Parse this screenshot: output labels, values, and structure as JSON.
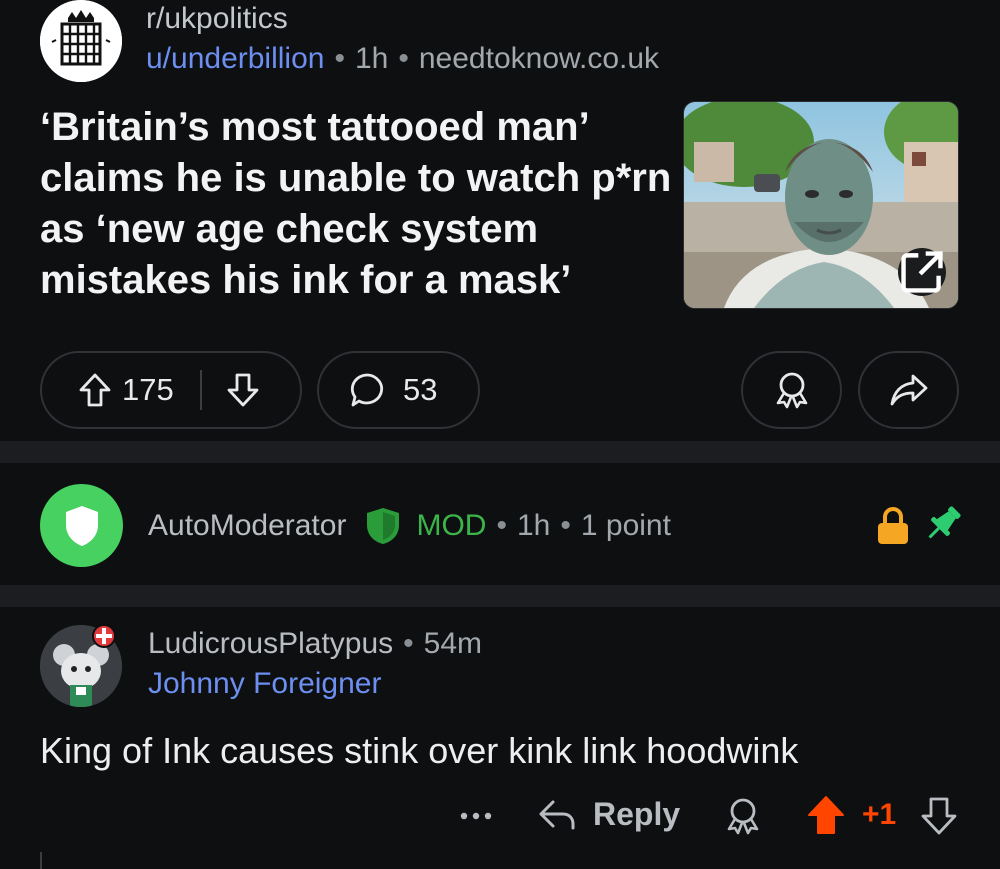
{
  "post": {
    "subreddit": "r/ukpolitics",
    "author": "u/underbillion",
    "age": "1h",
    "domain": "needtoknow.co.uk",
    "title": "‘Britain’s most tattooed man’ claims he is unable to watch p*rn as ‘new age check system mistakes his ink for a mask’",
    "score": "175",
    "comments": "53"
  },
  "automod": {
    "name": "AutoModerator",
    "badge": "MOD",
    "age": "1h",
    "points": "1 point"
  },
  "comment": {
    "author": "LudicrousPlatypus",
    "age": "54m",
    "flair": "Johnny Foreigner",
    "body": "King of Ink causes stink over kink link hoodwink",
    "reply_label": "Reply",
    "score": "+1"
  },
  "colors": {
    "accent_link": "#6c8ff0",
    "mod_green": "#3bb54a",
    "upvote_orange": "#ff4500",
    "lock_yellow": "#f5a623",
    "pin_green": "#2ecc71"
  },
  "icons": [
    "portcullis-icon",
    "external-link-icon",
    "upvote-icon",
    "downvote-icon",
    "comment-icon",
    "award-icon",
    "share-icon",
    "shield-icon",
    "lock-icon",
    "pin-icon",
    "more-icon",
    "reply-icon"
  ]
}
